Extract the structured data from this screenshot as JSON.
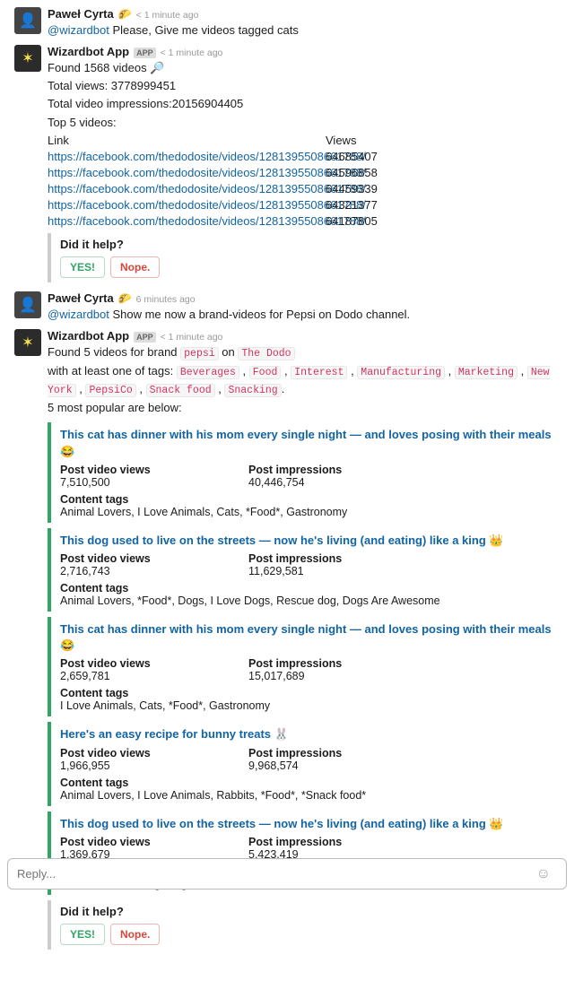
{
  "messages": [
    {
      "author": "Paweł Cyrta",
      "badge_emoji": "🌮",
      "timestamp": "< 1 minute ago",
      "mention": "@wizardbot",
      "text": "Please, Give me videos tagged cats"
    },
    {
      "author": "Wizardbot App",
      "app": "APP",
      "timestamp": "< 1 minute ago",
      "lines": [
        "Found 1568 videos 🔎",
        "Total views: 3778999451",
        "Total video impressions:20156904405",
        "Top 5 videos:"
      ],
      "table": {
        "headers": [
          "Link",
          "Views"
        ],
        "rows": [
          {
            "link": "https://facebook.com/thedodosite/videos/1281395508661788/",
            "views": "64685407"
          },
          {
            "link": "https://facebook.com/thedodosite/videos/1281395508661788/",
            "views": "64596858"
          },
          {
            "link": "https://facebook.com/thedodosite/videos/1281395508661788/",
            "views": "64459339"
          },
          {
            "link": "https://facebook.com/thedodosite/videos/1281395508661788/",
            "views": "64321377"
          },
          {
            "link": "https://facebook.com/thedodosite/videos/1281395508661788/",
            "views": "64187805"
          }
        ]
      },
      "help": {
        "question": "Did it help?",
        "yes": "YES!",
        "nope": "Nope."
      }
    },
    {
      "author": "Paweł Cyrta",
      "badge_emoji": "🌮",
      "timestamp": "6 minutes ago",
      "mention": "@wizardbot",
      "text": "Show me now a brand-videos for Pepsi on Dodo channel."
    },
    {
      "author": "Wizardbot App",
      "app": "APP",
      "timestamp": "< 1 minute ago",
      "brand_line": {
        "prefix": "Found 5 videos for brand ",
        "brand": "pepsi",
        "mid": " on ",
        "channel": "The Dodo"
      },
      "tags_line_prefix": "with at least one of tags: ",
      "tags": [
        "Beverages",
        "Food",
        "Interest",
        "Manufacturing",
        "Marketing",
        "New York",
        "PepsiCo",
        "Snack food",
        "Snacking"
      ],
      "summary": "5 most popular are below:",
      "videos": [
        {
          "title": "This cat has dinner with his mom every single night — and loves posing with their meals 😂",
          "views_label": "Post video views",
          "views": "7,510,500",
          "imp_label": "Post impressions",
          "imp": "40,446,754",
          "tags_label": "Content tags",
          "tags": "Animal Lovers, I Love Animals, Cats, *Food*, Gastronomy"
        },
        {
          "title": "This dog used to live on the streets — now he's living (and eating) like a king 👑",
          "views_label": "Post video views",
          "views": "2,716,743",
          "imp_label": "Post impressions",
          "imp": "11,629,581",
          "tags_label": "Content tags",
          "tags": "Animal Lovers, *Food*, Dogs, I Love Dogs, Rescue dog, Dogs Are Awesome"
        },
        {
          "title": "This cat has dinner with his mom every single night — and loves posing with their meals 😂",
          "views_label": "Post video views",
          "views": "2,659,781",
          "imp_label": "Post impressions",
          "imp": "15,017,689",
          "tags_label": "Content tags",
          "tags": "I Love Animals, Cats, *Food*, Gastronomy"
        },
        {
          "title": "Here's an easy recipe for bunny treats 🐰",
          "views_label": "Post video views",
          "views": "1,966,955",
          "imp_label": "Post impressions",
          "imp": "9,968,574",
          "tags_label": "Content tags",
          "tags": "Animal Lovers, I Love Animals, Rabbits, *Food*, *Snack food*"
        },
        {
          "title": "This dog used to live on the streets — now he's living (and eating) like a king 👑",
          "views_label": "Post video views",
          "views": "1,369,679",
          "imp_label": "Post impressions",
          "imp": "5,423,419",
          "tags_label": "Content tags",
          "tags": "*Food*, Rescue dog, Dogs Are Awesome"
        }
      ],
      "help": {
        "question": "Did it help?",
        "yes": "YES!",
        "nope": "Nope."
      }
    }
  ],
  "reply_placeholder": "Reply..."
}
